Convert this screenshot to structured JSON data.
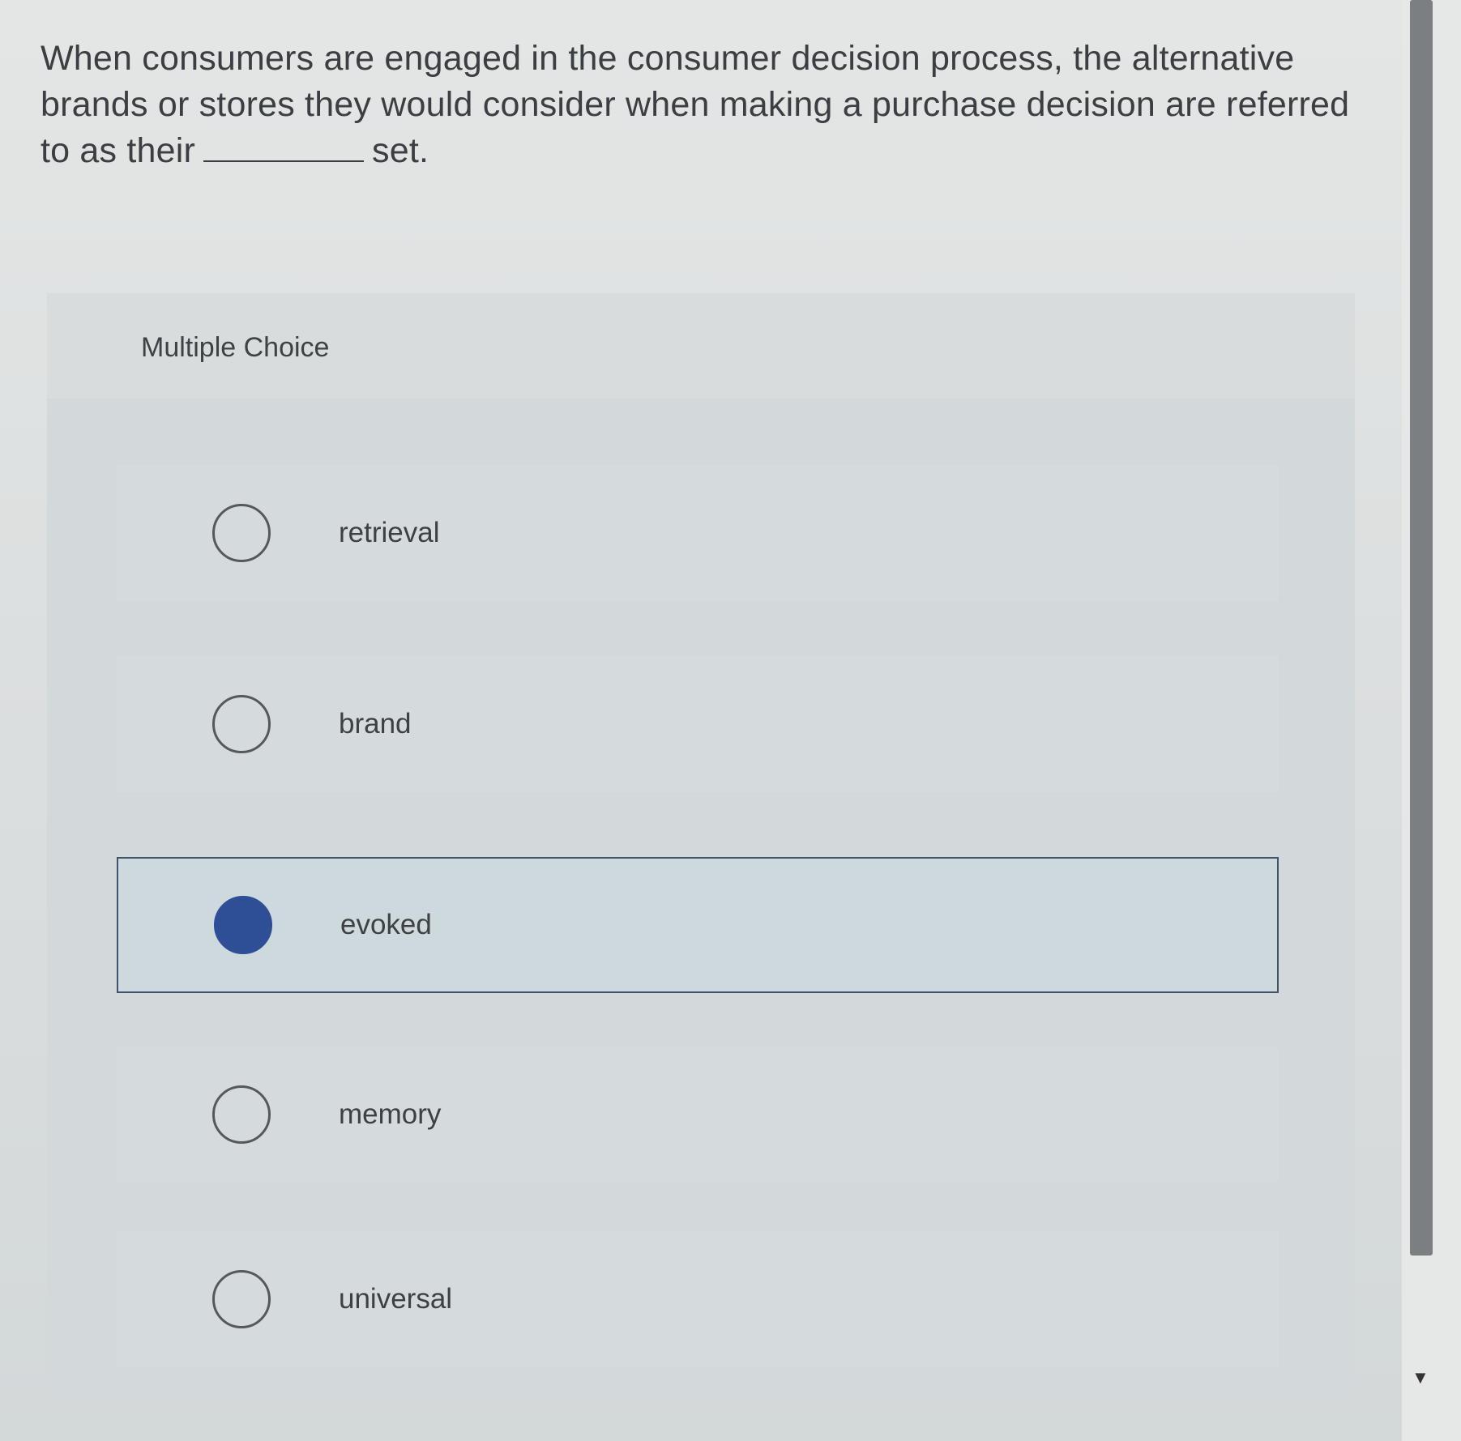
{
  "question": {
    "text_before_blank": "When consumers are engaged in the consumer decision process, the alternative brands or stores they would consider when making a purchase decision are referred to as their",
    "text_after_blank": "set."
  },
  "multiple_choice": {
    "title": "Multiple Choice",
    "options": [
      {
        "label": "retrieval",
        "selected": false
      },
      {
        "label": "brand",
        "selected": false
      },
      {
        "label": "evoked",
        "selected": true
      },
      {
        "label": "memory",
        "selected": false
      },
      {
        "label": "universal",
        "selected": false
      }
    ]
  },
  "colors": {
    "selected_radio": "#2e4e96",
    "selected_border": "#41536a",
    "text": "#3b3e42"
  },
  "icons": {
    "scroll_down": "down-arrow-icon"
  }
}
